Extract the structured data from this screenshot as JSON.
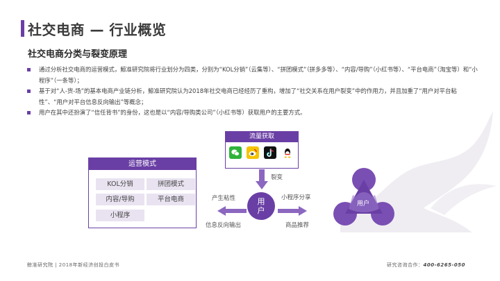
{
  "header": {
    "title": "社交电商 — 行业概览",
    "subtitle": "社交电商分类与裂变原理"
  },
  "bullets": [
    "通过分析社交电商的运营模式，鲸准研究院将行业划分为四类，分别为“KOL分销”（云集等）、“拼团模式”（拼多多等）、“内容/导购”（小红书等）、“平台电商”（淘宝等）和“小程序”（一条等）；",
    "基于对“人-货-场”的基本电商产业链分析，鲸准研究院认为2018年社交电商已经经历了重构，增加了“社交关系在用户裂变”中的作用力，并且加重了“用户对平台粘性”、“用户对平台信息反向输出”等概念；",
    "用户在其中还扮演了“信任背书”的身份，这也是以“内容/导购类公司”（小红书等）获取用户的主要方式。"
  ],
  "traffic": {
    "title": "流量获取",
    "icons": [
      "wechat-icon",
      "weibo-icon",
      "douyin-icon",
      "qq-icon"
    ]
  },
  "split_label": "裂变",
  "ops": {
    "title": "运营模式",
    "items": [
      "KOL分销",
      "拼团模式",
      "内容/导购",
      "平台电商",
      "小程序"
    ]
  },
  "user_circle": "用户",
  "labels": {
    "stickiness": "产生粘性",
    "reverse_output": "信息反向输出",
    "mini_share": "小程序分享",
    "product_rec": "商品推荐"
  },
  "triangle_label": "用户",
  "footer": {
    "left": "鲸准研究院 | 2018年新经济创投白皮书",
    "right_label": "研究咨询合作：",
    "right_phone": "400-6265-050"
  },
  "colors": {
    "accent": "#6a3fa5",
    "chip_bg": "#e9e3f1"
  }
}
